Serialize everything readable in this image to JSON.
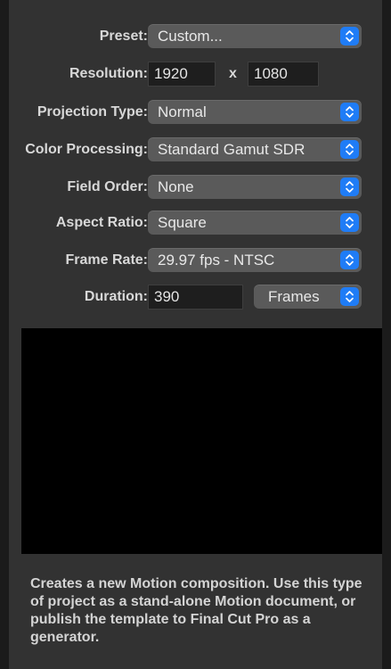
{
  "window": {
    "background": "#1b1b1b",
    "panel_color": "#323232",
    "accent_color": "#1f7cf6"
  },
  "settings": {
    "preset": {
      "label": "Preset:",
      "value": "Custom..."
    },
    "resolution": {
      "label": "Resolution:",
      "width": "1920",
      "separator": "x",
      "height": "1080"
    },
    "projection_type": {
      "label": "Projection Type:",
      "value": "Normal"
    },
    "color_processing": {
      "label": "Color Processing:",
      "value": "Standard Gamut SDR"
    },
    "field_order": {
      "label": "Field Order:",
      "value": "None"
    },
    "aspect_ratio": {
      "label": "Aspect Ratio:",
      "value": "Square"
    },
    "frame_rate": {
      "label": "Frame Rate:",
      "value": "29.97 fps - NTSC"
    },
    "duration": {
      "label": "Duration:",
      "value": "390",
      "unit": "Frames"
    }
  },
  "icons": {
    "popup_arrows": "chevron-up-down-icon"
  },
  "description": "Creates a new Motion composition. Use this type of project as a stand-alone Motion document, or publish the template to Final Cut Pro as a generator."
}
